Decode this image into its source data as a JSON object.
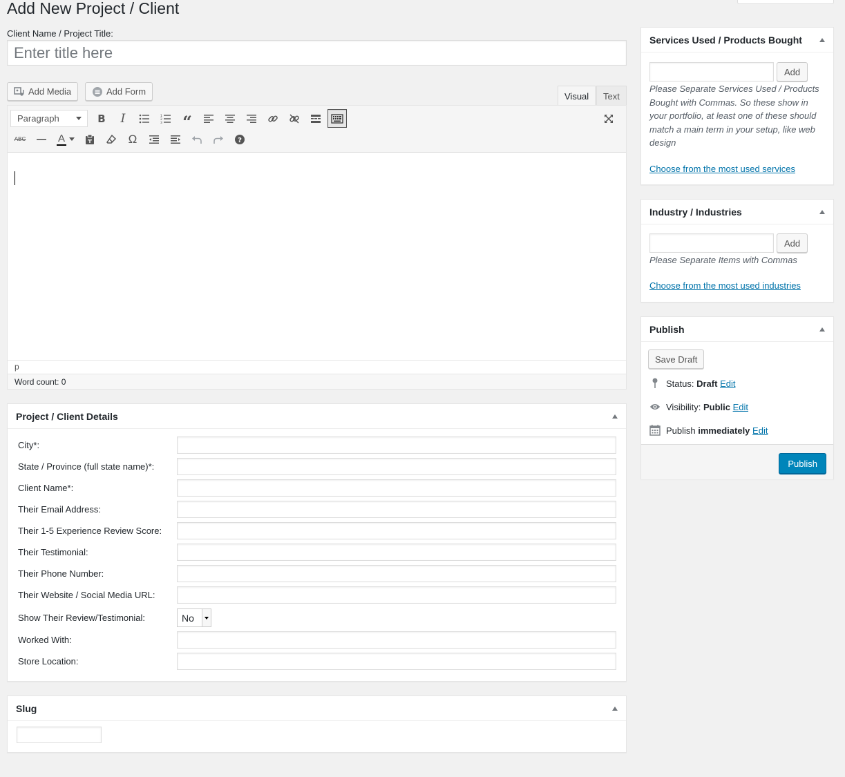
{
  "page": {
    "title": "Add New Project / Client"
  },
  "title_field": {
    "label": "Client Name / Project Title:",
    "placeholder": "Enter title here",
    "value": ""
  },
  "media": {
    "add_media": "Add Media",
    "add_form": "Add Form"
  },
  "editor": {
    "tabs": [
      {
        "label": "Visual",
        "active": true
      },
      {
        "label": "Text",
        "active": false
      }
    ],
    "format_select": "Paragraph",
    "path": "p",
    "word_count": "Word count: 0",
    "toolbar_row1": [
      "bold-icon",
      "italic-icon",
      "bulleted-list-icon",
      "numbered-list-icon",
      "blockquote-icon",
      "align-left-icon",
      "align-center-icon",
      "align-right-icon",
      "insert-link-icon",
      "remove-link-icon",
      "read-more-icon",
      "toolbar-toggle-icon"
    ],
    "toolbar_row2": [
      "strikethrough-icon",
      "horizontal-line-icon",
      "text-color-icon",
      "paste-as-text-icon",
      "clear-formatting-icon",
      "special-character-icon",
      "decrease-indent-icon",
      "increase-indent-icon",
      "undo-icon",
      "redo-icon",
      "help-icon"
    ]
  },
  "details": {
    "title": "Project / Client Details",
    "fields": [
      {
        "label": "City*:",
        "value": ""
      },
      {
        "label": "State / Province (full state name)*:",
        "value": ""
      },
      {
        "label": "Client Name*:",
        "value": ""
      },
      {
        "label": "Their Email Address:",
        "value": ""
      },
      {
        "label": "Their 1-5 Experience Review Score:",
        "value": ""
      },
      {
        "label": "Their Testimonial:",
        "value": ""
      },
      {
        "label": "Their Phone Number:",
        "value": ""
      },
      {
        "label": "Their Website / Social Media URL:",
        "value": ""
      },
      {
        "label": "Show Their Review/Testimonial:",
        "value": "No"
      },
      {
        "label": "Worked With:",
        "value": ""
      },
      {
        "label": "Store Location:",
        "value": ""
      }
    ]
  },
  "slug": {
    "title": "Slug",
    "value": ""
  },
  "services": {
    "title": "Services Used / Products Bought",
    "add_label": "Add",
    "help": "Please Separate Services Used / Products Bought with Commas. So these show in your portfolio, at least one of these should match a main term in your setup, like web design",
    "link": "Choose from the most used services"
  },
  "industries": {
    "title": "Industry / Industries",
    "add_label": "Add",
    "help": "Please Separate Items with Commas",
    "link": "Choose from the most used industries"
  },
  "publish": {
    "title": "Publish",
    "save_draft": "Save Draft",
    "status_label": "Status:",
    "status_value": "Draft",
    "visibility_label": "Visibility:",
    "visibility_value": "Public",
    "schedule_label": "Publish",
    "schedule_value": "immediately",
    "edit": "Edit",
    "publish_button": "Publish"
  },
  "colors": {
    "primary": "#0085ba",
    "link": "#0073aa",
    "background": "#f1f1f1"
  }
}
